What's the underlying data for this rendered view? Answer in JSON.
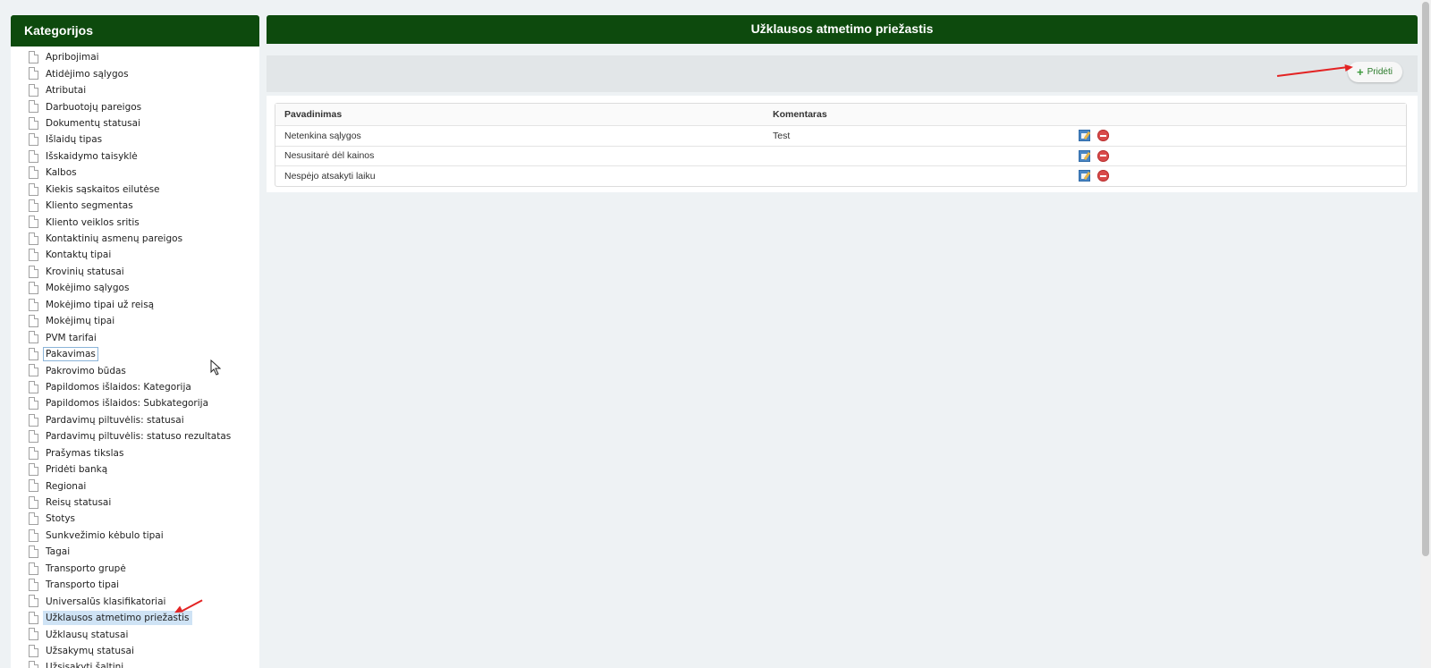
{
  "sidebar": {
    "title": "Kategorijos",
    "items": [
      {
        "label": "Apribojimai"
      },
      {
        "label": "Atidėjimo sąlygos"
      },
      {
        "label": "Atributai"
      },
      {
        "label": "Darbuotojų pareigos"
      },
      {
        "label": "Dokumentų statusai"
      },
      {
        "label": "Išlaidų tipas"
      },
      {
        "label": "Išskaidymo taisyklė"
      },
      {
        "label": "Kalbos"
      },
      {
        "label": "Kiekis sąskaitos eilutėse"
      },
      {
        "label": "Kliento segmentas"
      },
      {
        "label": "Kliento veiklos sritis"
      },
      {
        "label": "Kontaktinių asmenų pareigos"
      },
      {
        "label": "Kontaktų tipai"
      },
      {
        "label": "Krovinių statusai"
      },
      {
        "label": "Mokėjimo sąlygos"
      },
      {
        "label": "Mokėjimo tipai už reisą"
      },
      {
        "label": "Mokėjimų tipai"
      },
      {
        "label": "PVM tarifai"
      },
      {
        "label": "Pakavimas"
      },
      {
        "label": "Pakrovimo būdas"
      },
      {
        "label": "Papildomos išlaidos: Kategorija"
      },
      {
        "label": "Papildomos išlaidos: Subkategorija"
      },
      {
        "label": "Pardavimų piltuvėlis: statusai"
      },
      {
        "label": "Pardavimų piltuvėlis: statuso rezultatas"
      },
      {
        "label": "Prašymas tikslas"
      },
      {
        "label": "Pridėti banką"
      },
      {
        "label": "Regionai"
      },
      {
        "label": "Reisų statusai"
      },
      {
        "label": "Stotys"
      },
      {
        "label": "Sunkvežimio kėbulo tipai"
      },
      {
        "label": "Tagai"
      },
      {
        "label": "Transporto grupė"
      },
      {
        "label": "Transporto tipai"
      },
      {
        "label": "Universalūs klasifikatoriai"
      },
      {
        "label": "Užklausos atmetimo priežastis"
      },
      {
        "label": "Užklausų statusai"
      },
      {
        "label": "Užsakymų statusai"
      },
      {
        "label": "Užsisakyti šaltini"
      }
    ],
    "hovered_item": "Pakavimas",
    "selected_item": "Užklausos atmetimo priežastis"
  },
  "main": {
    "title": "Užklausos atmetimo priežastis",
    "toolbar": {
      "add_label": "Pridėti"
    },
    "table": {
      "columns": [
        "Pavadinimas",
        "Komentaras"
      ],
      "rows": [
        {
          "name": "Netenkina sąlygos",
          "comment": "Test"
        },
        {
          "name": "Nesusitarė dėl kainos",
          "comment": ""
        },
        {
          "name": "Nespėjo atsakyti laiku",
          "comment": ""
        }
      ]
    }
  },
  "colors": {
    "header_green": "#0d4a0d",
    "selected_bg": "#cfe3f5",
    "annotation_red": "#e32323"
  }
}
